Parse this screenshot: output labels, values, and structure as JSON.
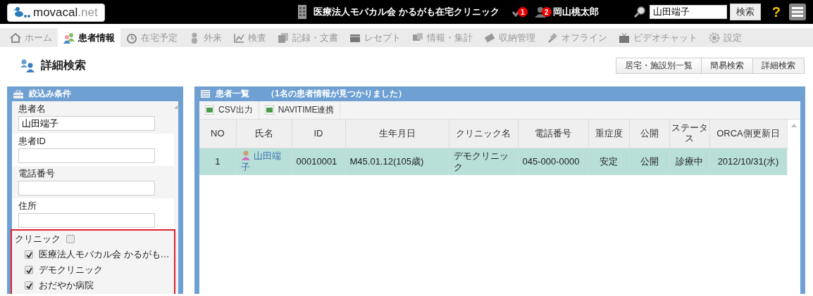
{
  "header": {
    "logo": {
      "name": "movacal",
      "suffix": ".net"
    },
    "clinic": "医療法人モバカル会 かるがも在宅クリニック",
    "task_count": "1",
    "user_count": "2",
    "user": "岡山桃太郎",
    "search": {
      "value": "山田端子",
      "button": "検索"
    },
    "help": "?"
  },
  "nav": [
    {
      "label": "ホーム",
      "selected": false
    },
    {
      "label": "患者情報",
      "selected": true
    },
    {
      "label": "在宅予定",
      "selected": false
    },
    {
      "label": "外来",
      "selected": false
    },
    {
      "label": "検査",
      "selected": false
    },
    {
      "label": "記録・文書",
      "selected": false
    },
    {
      "label": "レセプト",
      "selected": false
    },
    {
      "label": "情報・集計",
      "selected": false
    },
    {
      "label": "収納管理",
      "selected": false
    },
    {
      "label": "オフライン",
      "selected": false
    },
    {
      "label": "ビデオチャット",
      "selected": false
    },
    {
      "label": "設定",
      "selected": false
    }
  ],
  "page_title": "詳細検索",
  "view_buttons": [
    {
      "label": "居宅・施設別一覧",
      "selected": false
    },
    {
      "label": "簡易検索",
      "selected": false
    },
    {
      "label": "詳細検索",
      "selected": true
    }
  ],
  "filter": {
    "title": "絞込み条件",
    "fields": [
      {
        "label": "患者名",
        "value": "山田端子"
      },
      {
        "label": "患者ID"
      },
      {
        "label": "電話番号"
      },
      {
        "label": "住所"
      }
    ],
    "clinic": {
      "label": "クリニック",
      "checked": false,
      "highlighted": true,
      "options": [
        {
          "label": "医療法人モバカル会 かるがも…",
          "checked": true
        },
        {
          "label": "デモクリニック",
          "checked": true
        },
        {
          "label": "おだやか病院",
          "checked": true
        }
      ]
    }
  },
  "patients": {
    "title": "患者一覧",
    "summary": "（1名の患者情報が見つかりました）",
    "actions": [
      "CSV出力",
      "NAVITIME連携"
    ],
    "columns": [
      "NO",
      "氏名",
      "ID",
      "生年月日",
      "クリニック名",
      "電話番号",
      "重症度",
      "公開",
      "ステータス",
      "ORCA側更新日"
    ],
    "rows": [
      {
        "selected": true,
        "cells": [
          "1",
          "山田端子",
          "00010001",
          "M45.01.12(105歳)",
          "デモクリニック",
          "045-000-0000",
          "安定",
          "公開",
          "診療中",
          "2012/10/31(水)"
        ]
      }
    ]
  }
}
